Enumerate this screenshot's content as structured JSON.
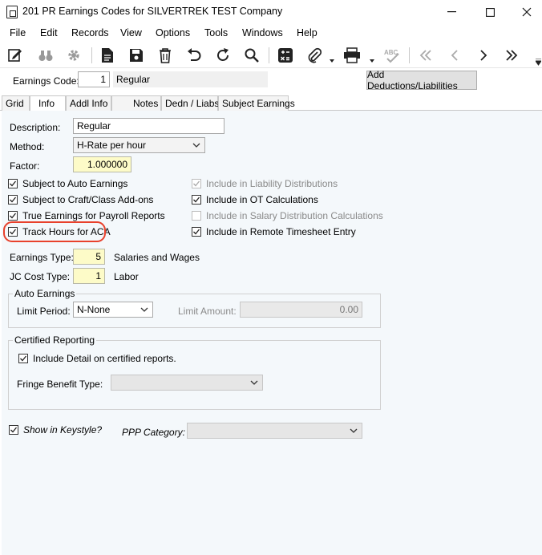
{
  "window": {
    "title": "201 PR Earnings Codes for SILVERTREK TEST Company",
    "minimize": "—",
    "maximize": "☐",
    "close": "✕"
  },
  "menu": [
    "File",
    "Edit",
    "Records",
    "View",
    "Options",
    "Tools",
    "Windows",
    "Help"
  ],
  "toolbar": {
    "icons": [
      "edit-icon",
      "binoculars-icon",
      "gear-icon",
      "document-icon",
      "save-icon",
      "delete-icon",
      "undo-icon",
      "refresh-icon",
      "search-icon",
      "calculator-icon",
      "paperclip-icon",
      "print-icon",
      "spellcheck-icon",
      "first-record-icon",
      "previous-record-icon",
      "next-record-icon",
      "last-record-icon"
    ]
  },
  "code_bar": {
    "label": "Earnings Code:",
    "code": "1",
    "name": "Regular",
    "button": "Add Deductions/Liabilities"
  },
  "tabs": [
    "Grid",
    "Info",
    "Addl Info",
    "Notes",
    "Dedn / Liabs",
    "Subject Earnings"
  ],
  "active_tab": "Info",
  "form": {
    "description_label": "Description:",
    "description": "Regular",
    "method_label": "Method:",
    "method": "H-Rate per hour",
    "factor_label": "Factor:",
    "factor": "1.000000",
    "checks_left": [
      {
        "label": "Subject to Auto Earnings",
        "checked": true
      },
      {
        "label": "Subject to Craft/Class Add-ons",
        "checked": true
      },
      {
        "label": "True Earnings for Payroll Reports",
        "checked": true
      },
      {
        "label": "Track Hours for ACA",
        "checked": true
      }
    ],
    "checks_right": [
      {
        "label": "Include in Liability Distributions",
        "checked": true,
        "disabled": true
      },
      {
        "label": "Include in OT Calculations",
        "checked": true,
        "disabled": false
      },
      {
        "label": "Include in Salary Distribution Calculations",
        "checked": false,
        "disabled": true
      },
      {
        "label": "Include in Remote Timesheet Entry",
        "checked": true,
        "disabled": false
      }
    ],
    "earnings_type_label": "Earnings Type:",
    "earnings_type": "5",
    "earnings_type_desc": "Salaries and Wages",
    "jc_cost_type_label": "JC Cost Type:",
    "jc_cost_type": "1",
    "jc_cost_type_desc": "Labor",
    "auto_earnings": {
      "title": "Auto Earnings",
      "limit_period_label": "Limit Period:",
      "limit_period": "N-None",
      "limit_amount_label": "Limit Amount:",
      "limit_amount": "0.00"
    },
    "certified": {
      "title": "Certified Reporting",
      "include_detail_label": "Include Detail on certified reports.",
      "include_detail": true,
      "fringe_label": "Fringe Benefit Type:",
      "fringe": ""
    },
    "show_keystyle_label": "Show in Keystyle?",
    "show_keystyle": true,
    "ppp_label": "PPP Category:",
    "ppp": ""
  },
  "highlight_color": "#e8412c"
}
